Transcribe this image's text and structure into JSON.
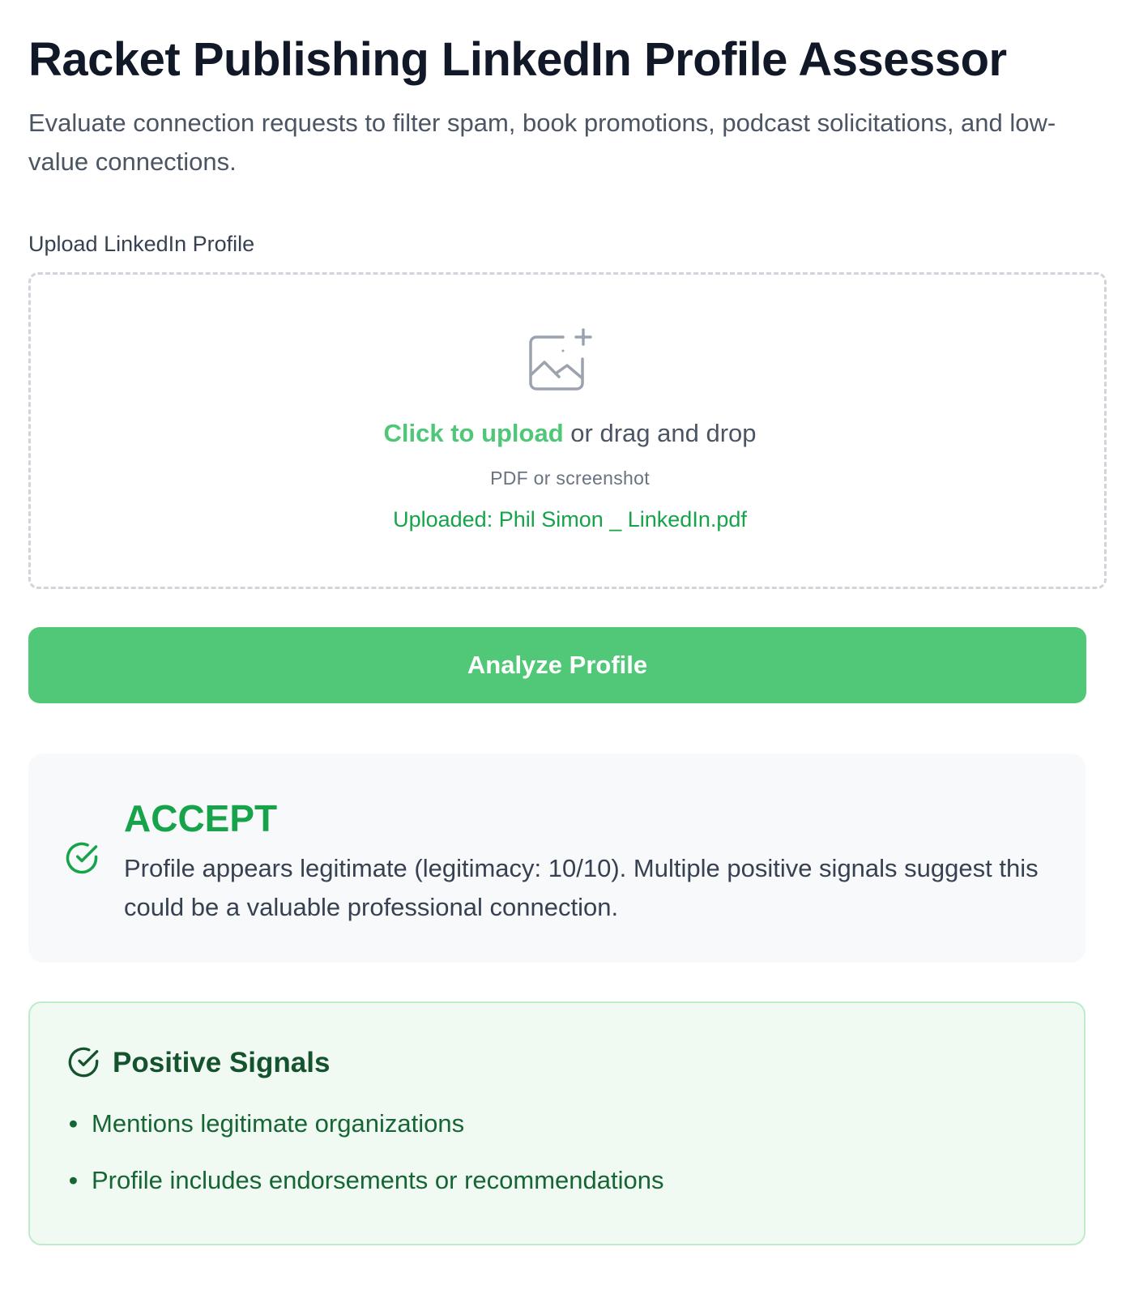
{
  "header": {
    "title": "Racket Publishing LinkedIn Profile Assessor",
    "subtitle": "Evaluate connection requests to filter spam, book promotions, podcast solicitations, and low-value connections."
  },
  "upload": {
    "label": "Upload LinkedIn Profile",
    "icon": "image-plus-icon",
    "link_text": "Click to upload",
    "drag_text": " or drag and drop",
    "hint": "PDF or screenshot",
    "uploaded_file": "Uploaded: Phil Simon _ LinkedIn.pdf"
  },
  "analyze_button": {
    "label": "Analyze Profile"
  },
  "verdict": {
    "icon": "check-circle-icon",
    "title": "ACCEPT",
    "text": "Profile appears legitimate (legitimacy: 10/10). Multiple positive signals suggest this could be a valuable professional connection."
  },
  "positive_signals": {
    "icon": "check-circle-icon",
    "title": "Positive Signals",
    "bullet": "•",
    "items": [
      "Mentions legitimate organizations",
      "Profile includes endorsements or recommendations"
    ]
  },
  "colors": {
    "accent_green": "#50c878",
    "link_green": "#4fc778",
    "success_green": "#16a34a",
    "signals_background": "#f0faf3",
    "title_text": "#111827"
  }
}
